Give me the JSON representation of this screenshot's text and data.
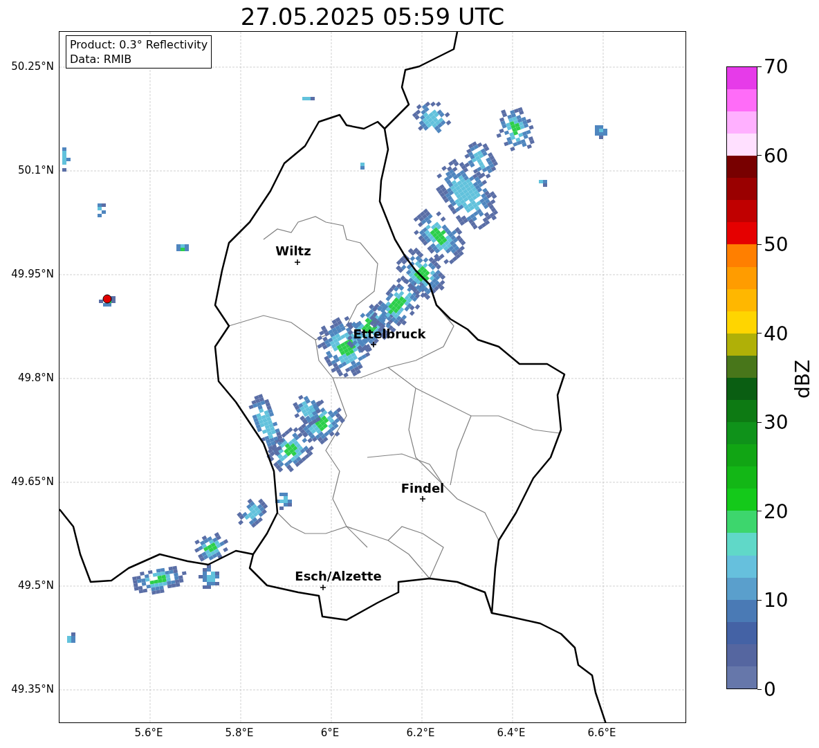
{
  "title": "27.05.2025 05:59 UTC",
  "info_box": [
    "Product: 0.3° Reflectivity",
    "Data: RMIB"
  ],
  "map": {
    "latitude_labels": [
      "50.25°N",
      "50.1°N",
      "49.95°N",
      "49.8°N",
      "49.65°N",
      "49.5°N",
      "49.35°N"
    ],
    "longitude_labels": [
      "5.6°E",
      "5.8°E",
      "6°E",
      "6.2°E",
      "6.4°E",
      "6.6°E"
    ],
    "cities": [
      {
        "name": "Wiltz"
      },
      {
        "name": "Ettelbruck"
      },
      {
        "name": "Findel"
      },
      {
        "name": "Esch/Alzette"
      }
    ]
  },
  "colorbar": {
    "label": "dBZ",
    "ticks": [
      "70",
      "60",
      "50",
      "40",
      "30",
      "20",
      "10",
      "0"
    ],
    "segments": [
      {
        "color": "#6677aa"
      },
      {
        "color": "#5566a0"
      },
      {
        "color": "#4462a5"
      },
      {
        "color": "#4a7ab5"
      },
      {
        "color": "#5a9fcc"
      },
      {
        "color": "#66c0dd"
      },
      {
        "color": "#60d8c8"
      },
      {
        "color": "#3dd66d"
      },
      {
        "color": "#14c91a"
      },
      {
        "color": "#13b716"
      },
      {
        "color": "#11a514"
      },
      {
        "color": "#0f921a"
      },
      {
        "color": "#0d7a13"
      },
      {
        "color": "#0a5e12"
      },
      {
        "color": "#48761a"
      },
      {
        "color": "#b0b007"
      },
      {
        "color": "#ffd500"
      },
      {
        "color": "#ffb700"
      },
      {
        "color": "#ff9c00"
      },
      {
        "color": "#ff7f00"
      },
      {
        "color": "#e50000"
      },
      {
        "color": "#c00000"
      },
      {
        "color": "#9a0000"
      },
      {
        "color": "#780000"
      },
      {
        "color": "#ffe0ff"
      },
      {
        "color": "#ffb0ff"
      },
      {
        "color": "#ff6cf8"
      },
      {
        "color": "#e63be9"
      }
    ]
  }
}
